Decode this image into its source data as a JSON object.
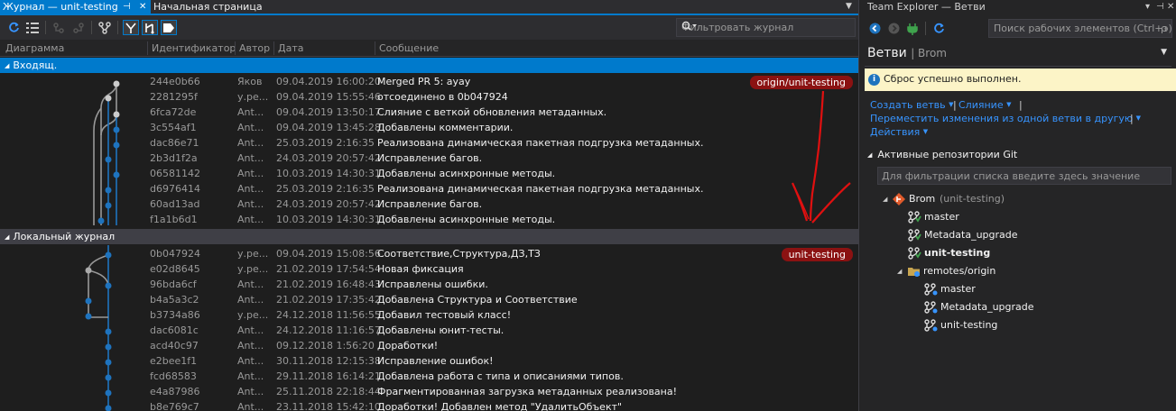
{
  "tabs": {
    "active": "Журнал — unit-testing",
    "pin": "⊣",
    "close": "✕",
    "second": "Начальная страница"
  },
  "filter": {
    "placeholder": "Фильтровать журнал"
  },
  "columns": {
    "graph": "Диаграмма",
    "id": "Идентификатор",
    "author": "Автор",
    "date": "Дата",
    "message": "Сообщение"
  },
  "incoming": {
    "label": "Входящ.",
    "rows": [
      {
        "id": "244e0b66",
        "author": "Яков",
        "date": "09.04.2019 16:00:20",
        "message": "Merged PR 5: ayay",
        "badge": "origin/unit-testing"
      },
      {
        "id": "2281295f",
        "author": "у.ре...",
        "date": "09.04.2019 15:55:46",
        "message": "отсоединено в 0b047924"
      },
      {
        "id": "6fca72de",
        "author": "Ant...",
        "date": "09.04.2019 13:50:17",
        "message": "Слияние с веткой обновления метаданных."
      },
      {
        "id": "3c554af1",
        "author": "Ant...",
        "date": "09.04.2019 13:45:28",
        "message": "Добавлены комментарии."
      },
      {
        "id": "dac86e71",
        "author": "Ant...",
        "date": "25.03.2019 2:16:35",
        "message": "Реализована динамическая пакетная подгрузка метаданных."
      },
      {
        "id": "2b3d1f2a",
        "author": "Ant...",
        "date": "24.03.2019 20:57:42",
        "message": "Исправление багов."
      },
      {
        "id": "06581142",
        "author": "Ant...",
        "date": "10.03.2019 14:30:31",
        "message": "Добавлены асинхронные методы."
      },
      {
        "id": "d6976414",
        "author": "Ant...",
        "date": "25.03.2019 2:16:35",
        "message": "Реализована динамическая пакетная подгрузка метаданных."
      },
      {
        "id": "60ad13ad",
        "author": "Ant...",
        "date": "24.03.2019 20:57:42",
        "message": "Исправление багов."
      },
      {
        "id": "f1a1b6d1",
        "author": "Ant...",
        "date": "10.03.2019 14:30:31",
        "message": "Добавлены асинхронные методы."
      }
    ]
  },
  "local": {
    "label": "Локальный журнал",
    "rows": [
      {
        "id": "0b047924",
        "author": "у.ре...",
        "date": "09.04.2019 15:08:56",
        "message": "Соответствие,Структура,ДЗ,ТЗ",
        "badge": "unit-testing"
      },
      {
        "id": "e02d8645",
        "author": "у.ре...",
        "date": "21.02.2019 17:54:54",
        "message": "Новая фиксация"
      },
      {
        "id": "96bda6cf",
        "author": "Ant...",
        "date": "21.02.2019 16:48:43",
        "message": "Исправлены ошибки."
      },
      {
        "id": "b4a5a3c2",
        "author": "Ant...",
        "date": "21.02.2019 17:35:42",
        "message": "Добавлена Структура и Соответствие"
      },
      {
        "id": "b3734a86",
        "author": "у.ре...",
        "date": "24.12.2018 11:56:55",
        "message": "Добавил тестовый класс!"
      },
      {
        "id": "dac6081c",
        "author": "Ant...",
        "date": "24.12.2018 11:16:57",
        "message": "Добавлены юнит-тесты."
      },
      {
        "id": "acd40c97",
        "author": "Ant...",
        "date": "09.12.2018 1:56:20",
        "message": "Доработки!"
      },
      {
        "id": "e2bee1f1",
        "author": "Ant...",
        "date": "30.11.2018 12:15:38",
        "message": "Исправление ошибок!"
      },
      {
        "id": "fcd68583",
        "author": "Ant...",
        "date": "29.11.2018 16:14:21",
        "message": "Добавлена работа с типа и описаниями типов."
      },
      {
        "id": "e4a87986",
        "author": "Ant...",
        "date": "25.11.2018 22:18:44",
        "message": "Фрагментированная загрузка метаданных реализована!"
      },
      {
        "id": "b8e769c7",
        "author": "Ant...",
        "date": "23.11.2018 15:42:10",
        "message": "Доработки! Добавлен метод \"УдалитьОбъект\""
      }
    ]
  },
  "team_explorer": {
    "title": "Team Explorer — Ветви",
    "search_placeholder": "Поиск рабочих элементов (Ctrl+э)",
    "search_shortcut": "ρ",
    "header": "Ветви",
    "header_sub": "Brom",
    "info": "Сброс успешно выполнен.",
    "links": {
      "create_branch": "Создать ветвь",
      "merge": "Слияние",
      "move_changes": "Переместить изменения из одной ветви в другую",
      "actions": "Действия"
    },
    "repos_section": "Активные репозитории Git",
    "repos_filter": "Для фильтрации списка введите здесь значение",
    "repo": {
      "name": "Brom",
      "branch": "(unit-testing)"
    },
    "branches": [
      "master",
      "Metadata_upgrade",
      "unit-testing"
    ],
    "remotes": "remotes/origin",
    "remote_branches": [
      "master",
      "Metadata_upgrade",
      "unit-testing"
    ]
  },
  "colors": {
    "accent": "#007acc",
    "badge": "#8b1212",
    "annotation": "#e01010",
    "link": "#3794ff"
  }
}
